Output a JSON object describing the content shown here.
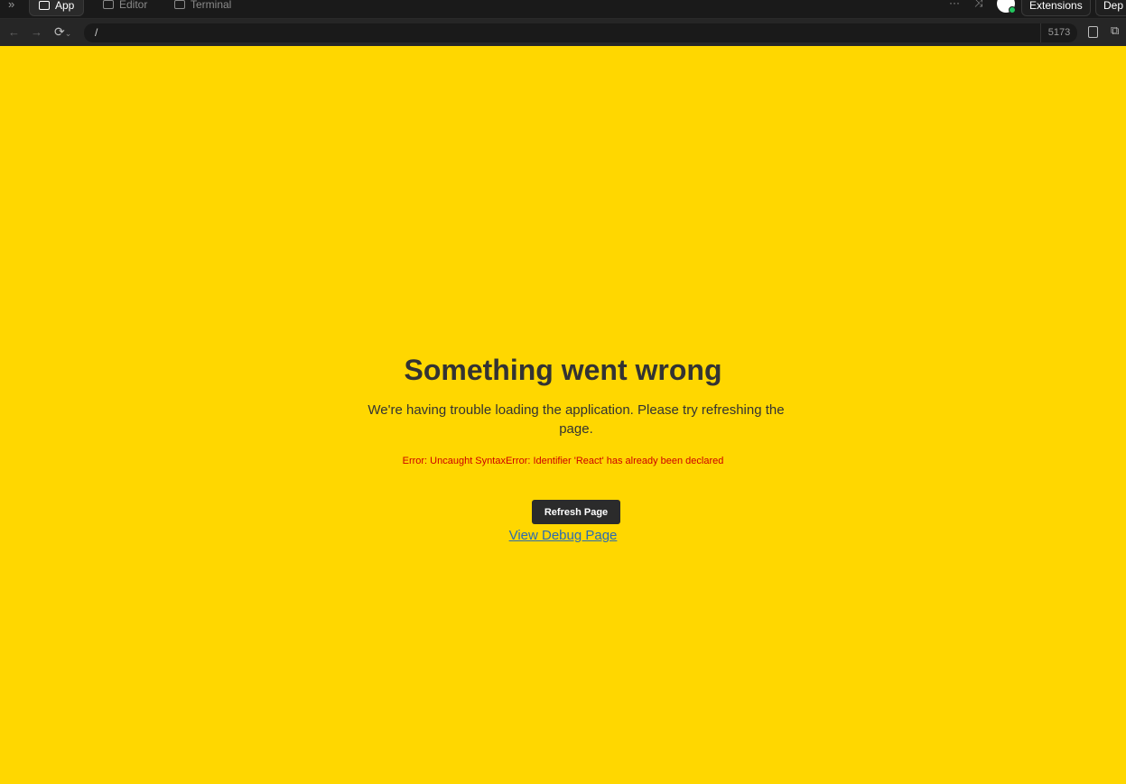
{
  "topbar": {
    "tabs": [
      {
        "label": "App"
      },
      {
        "label": "Editor"
      },
      {
        "label": "Terminal"
      }
    ],
    "more_label": "···",
    "extensions_label": "Extensions",
    "deploy_label": "Dep"
  },
  "navbar": {
    "url_path": "/",
    "port": "5173"
  },
  "main": {
    "title": "Something went wrong",
    "description": "We're having trouble loading the application. Please try refreshing the page.",
    "error": "Error: Uncaught SyntaxError: Identifier 'React' has already been declared",
    "refresh_label": "Refresh Page",
    "debug_link_label": "View Debug Page"
  },
  "colors": {
    "background": "#ffd700",
    "text": "#333333",
    "error": "#cc0000",
    "link": "#2b6cb0",
    "button": "#2b2b2b"
  }
}
